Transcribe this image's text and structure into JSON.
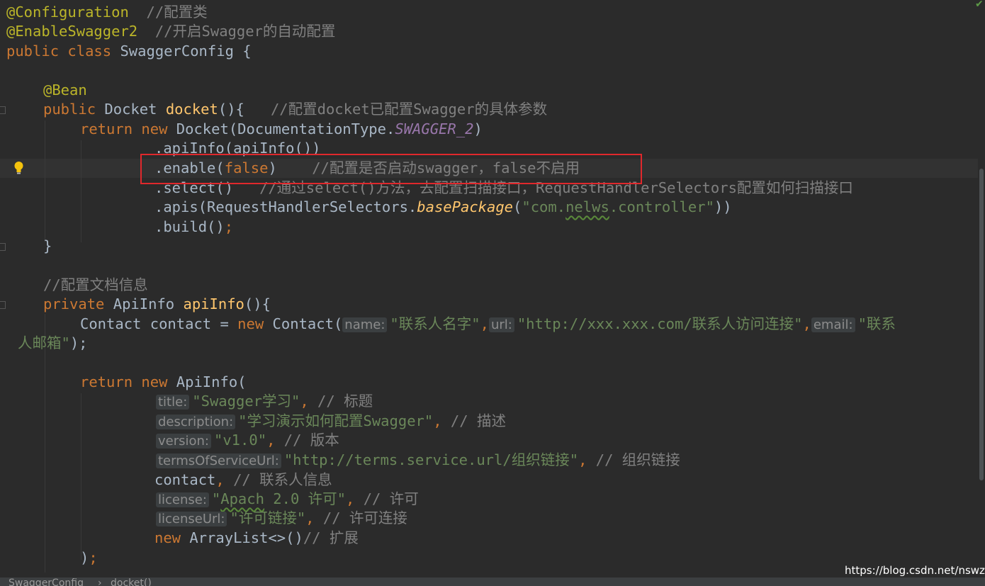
{
  "editor": {
    "l1": {
      "annotation": "@Configuration",
      "comment": "//配置类"
    },
    "l2": {
      "annotation": "@EnableSwagger2",
      "comment": "//开启Swagger的自动配置"
    },
    "l3": {
      "kw1": "public",
      "kw2": "class",
      "name": "SwaggerConfig {"
    },
    "l5": {
      "annotation": "@Bean"
    },
    "l6": {
      "kw": "public",
      "type": "Docket",
      "method": "docket",
      "paren": "(){",
      "comment": "//配置docket已配置Swagger的具体参数"
    },
    "l7": {
      "kw1": "return",
      "kw2": "new",
      "code": "Docket(DocumentationType.",
      "const": "SWAGGER_2",
      "close": ")"
    },
    "l8": {
      "code": ".apiInfo(apiInfo())"
    },
    "l9": {
      "code": ".enable(",
      "value": "false",
      "close": ")",
      "comment": "//配置是否启动swagger，false不启用"
    },
    "l10": {
      "code": ".select()",
      "comment": "//通过select()方法，去配置扫描接口，RequestHandlerSelectors配置如何扫描接口"
    },
    "l11": {
      "code1": ".apis(RequestHandlerSelectors.",
      "method": "basePackage",
      "open": "(",
      "str_a": "\"com.",
      "str_b": "nelws",
      "str_c": ".controller\"",
      "close": "))"
    },
    "l12": {
      "code": ".build()",
      "semi": ";"
    },
    "l13": {
      "code": "}"
    },
    "l15": {
      "comment": "//配置文档信息"
    },
    "l16": {
      "kw": "private",
      "type": "ApiInfo",
      "method": "apiInfo",
      "paren": "(){"
    },
    "l17": {
      "code1": "Contact contact = ",
      "kw": "new",
      "code2": "Contact(",
      "hint_name": "name:",
      "str_name": "\"联系人名字\"",
      "comma1": ",",
      "hint_url": "url:",
      "str_url": "\"http://xxx.xxx.com/联系人访问连接\"",
      "comma2": ",",
      "hint_email": "email:",
      "str_email": "\"联系"
    },
    "l18": {
      "str": "人邮箱\"",
      "close": ");"
    },
    "l20": {
      "kw1": "return",
      "kw2": "new",
      "code": "ApiInfo("
    },
    "l21": {
      "hint": "title:",
      "str": "\"Swagger学习\"",
      "comma": ",",
      "comment": "// 标题"
    },
    "l22": {
      "hint": "description:",
      "str": "\"学习演示如何配置Swagger\"",
      "comma": ",",
      "comment": "// 描述"
    },
    "l23": {
      "hint": "version:",
      "str": "\"v1.0\"",
      "comma": ",",
      "comment": "// 版本"
    },
    "l24": {
      "hint": "termsOfServiceUrl:",
      "str": "\"http://terms.service.url/组织链接\"",
      "comma": ",",
      "comment": "// 组织链接"
    },
    "l25": {
      "code": "contact",
      "comma": ",",
      "comment": "// 联系人信息"
    },
    "l26": {
      "hint": "license:",
      "q": "\"",
      "sq": "Apach",
      "str": " 2.0 许可\"",
      "comma": ",",
      "comment": "// 许可"
    },
    "l27": {
      "hint": "licenseUrl:",
      "str": "\"许可链接\"",
      "comma": ",",
      "comment": "// 许可连接"
    },
    "l28": {
      "kw": "new",
      "code": "ArrayList<>()",
      "comment": "// 扩展"
    },
    "l29": {
      "code": ")",
      "semi": ";"
    }
  },
  "breadcrumb": {
    "class_name": "SwaggerConfig",
    "sep": "›",
    "method_name": "docket()"
  },
  "watermark": "https://blog.csdn.net/nswzr",
  "icons": [
    "lightbulb-icon",
    "checkmark-icon",
    "fold-marker-icon"
  ],
  "colors": {
    "keyword": "#cc7832",
    "annotation": "#bbb529",
    "string": "#6a8759",
    "comment": "#808080",
    "highlight_box": "#e0282c"
  }
}
